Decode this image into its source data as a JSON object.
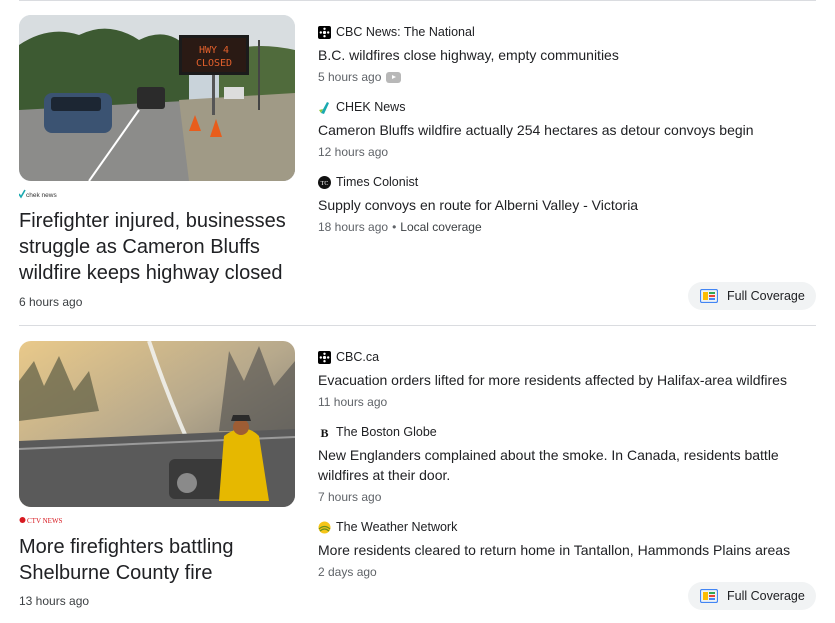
{
  "clusters": [
    {
      "main": {
        "source": "chek news",
        "title": "Firefighter injured, businesses struggle as Cameron Bluffs wildfire keeps highway closed",
        "time": "6 hours ago",
        "sign_line1": "HWY 4",
        "sign_line2": "CLOSED"
      },
      "articles": [
        {
          "source": "CBC News: The National",
          "icon": "cbc-gem-icon",
          "title": "B.C. wildfires close highway, empty communities",
          "time": "5 hours ago",
          "video": true
        },
        {
          "source": "CHEK News",
          "icon": "chek-icon",
          "title": "Cameron Bluffs wildfire actually 254 hectares as detour convoys begin",
          "time": "12 hours ago"
        },
        {
          "source": "Times Colonist",
          "icon": "tc-icon",
          "title": "Supply convoys en route for Alberni Valley - Victoria",
          "time": "18 hours ago",
          "extra": "Local coverage"
        }
      ],
      "full_coverage": "Full Coverage"
    },
    {
      "main": {
        "source": "CTV NEWS",
        "title": "More firefighters battling Shelburne County fire",
        "time": "13 hours ago"
      },
      "articles": [
        {
          "source": "CBC.ca",
          "icon": "cbc-gem-icon",
          "title": "Evacuation orders lifted for more residents affected by Halifax-area wildfires",
          "time": "11 hours ago"
        },
        {
          "source": "The Boston Globe",
          "icon": "boston-globe-icon",
          "title": "New Englanders complained about the smoke. In Canada, residents battle wildfires at their door.",
          "time": "7 hours ago"
        },
        {
          "source": "The Weather Network",
          "icon": "weather-network-icon",
          "title": "More residents cleared to return home in Tantallon, Hammonds Plains areas",
          "time": "2 days ago"
        }
      ],
      "full_coverage": "Full Coverage"
    }
  ],
  "colors": {
    "fire_yellow": "#e6b800",
    "chek_accent": "#1aa9b0",
    "sign_led": "#e2602c"
  }
}
